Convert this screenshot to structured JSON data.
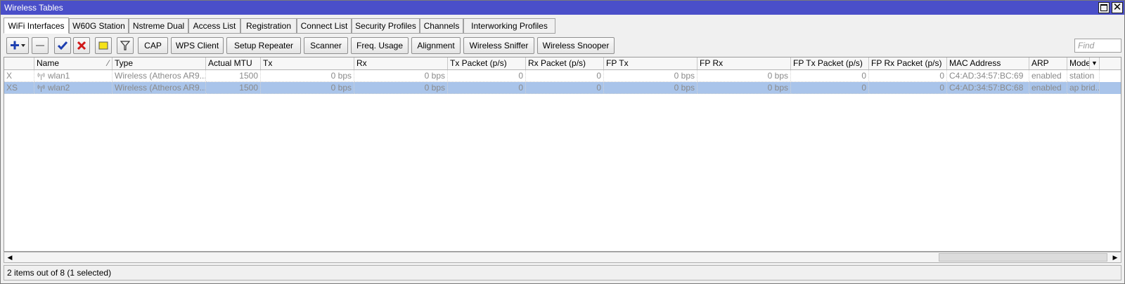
{
  "window": {
    "title": "Wireless Tables"
  },
  "tabs": [
    {
      "label": "WiFi Interfaces",
      "active": true
    },
    {
      "label": "W60G Station"
    },
    {
      "label": "Nstreme Dual"
    },
    {
      "label": "Access List"
    },
    {
      "label": "Registration"
    },
    {
      "label": "Connect List"
    },
    {
      "label": "Security Profiles"
    },
    {
      "label": "Channels"
    },
    {
      "label": "Interworking Profiles"
    }
  ],
  "toolbar": {
    "icons": [
      "add-icon",
      "remove-icon",
      "enable-check-icon",
      "disable-x-icon",
      "comment-note-icon",
      "filter-icon"
    ],
    "buttons": [
      "CAP",
      "WPS Client",
      "Setup Repeater",
      "Scanner",
      "Freq. Usage",
      "Alignment",
      "Wireless Sniffer",
      "Wireless Snooper"
    ],
    "find_placeholder": "Find"
  },
  "table": {
    "columns": [
      "",
      "Name",
      "Type",
      "Actual MTU",
      "Tx",
      "Rx",
      "Tx Packet (p/s)",
      "Rx Packet (p/s)",
      "FP Tx",
      "FP Rx",
      "FP Tx Packet (p/s)",
      "FP Rx Packet (p/s)",
      "MAC Address",
      "ARP",
      "Mode"
    ],
    "rows": [
      {
        "flags": "X",
        "name": "wlan1",
        "type": "Wireless (Atheros AR9...",
        "mtu": "1500",
        "tx": "0 bps",
        "rx": "0 bps",
        "txp": "0",
        "rxp": "0",
        "fptx": "0 bps",
        "fprx": "0 bps",
        "fptxp": "0",
        "fprxp": "0",
        "mac": "C4:AD:34:57:BC:69",
        "arp": "enabled",
        "mode": "station",
        "selected": false
      },
      {
        "flags": "XS",
        "name": "wlan2",
        "type": "Wireless (Atheros AR9...",
        "mtu": "1500",
        "tx": "0 bps",
        "rx": "0 bps",
        "txp": "0",
        "rxp": "0",
        "fptx": "0 bps",
        "fprx": "0 bps",
        "fptxp": "0",
        "fprxp": "0",
        "mac": "C4:AD:34:57:BC:68",
        "arp": "enabled",
        "mode": "ap brid...",
        "selected": true
      }
    ]
  },
  "status": {
    "text": "2 items out of 8 (1 selected)"
  },
  "colors": {
    "titlebar": "#4a4fc9",
    "selected_row": "#a9c4ea"
  }
}
